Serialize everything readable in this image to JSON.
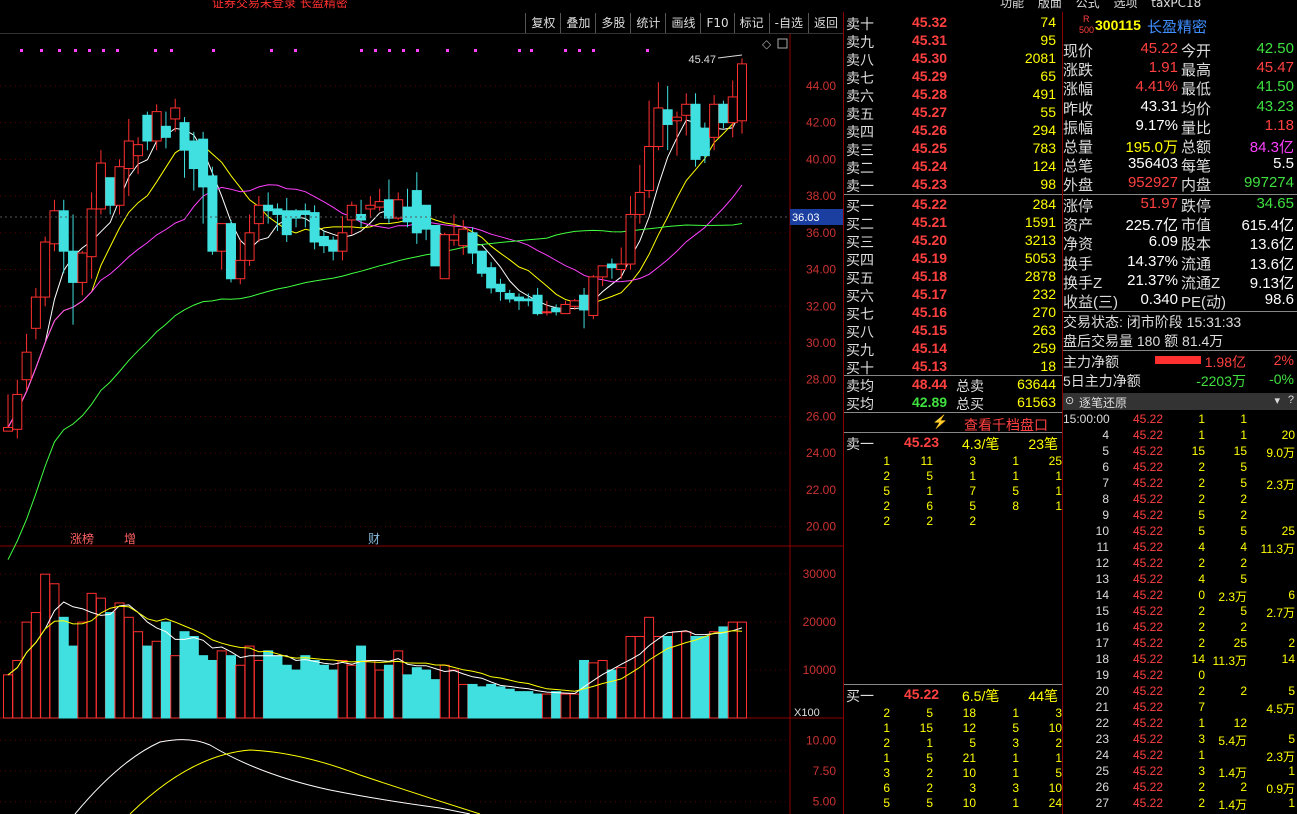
{
  "top_status_text": "证券交易未登录 长盈精密",
  "top_right_menu": [
    "功能",
    "版面",
    "公式",
    "选项",
    "taxPC18"
  ],
  "toolbar": [
    "复权",
    "叠加",
    "多股",
    "统计",
    "画线",
    "F10",
    "标记",
    "-自选",
    "返回"
  ],
  "chart_labels": {
    "high_marker": "45.47",
    "cursor_price": "36.03",
    "vol_unit": "X100",
    "events": [
      "涨榜",
      "增",
      "财"
    ]
  },
  "price_axis": [
    "44.00",
    "42.00",
    "40.00",
    "38.00",
    "36.00",
    "34.00",
    "32.00",
    "30.00",
    "28.00",
    "26.00",
    "24.00",
    "22.00",
    "20.00"
  ],
  "vol_axis": [
    "30000",
    "20000",
    "10000"
  ],
  "macd_axis": [
    "10.00",
    "7.50",
    "5.00"
  ],
  "chart_data": {
    "type": "candlestick",
    "ylim": [
      19,
      46.5
    ],
    "candles": [
      [
        25.2,
        25.4,
        27.2,
        25.2
      ],
      [
        25.3,
        27.2,
        28.0,
        24.8
      ],
      [
        28.0,
        29.5,
        30.5,
        27.4
      ],
      [
        30.8,
        32.5,
        33.0,
        30.2
      ],
      [
        32.5,
        35.5,
        35.8,
        32.0
      ],
      [
        35.4,
        37.2,
        37.8,
        35.0
      ],
      [
        37.2,
        35.0,
        37.8,
        33.8
      ],
      [
        35.0,
        33.3,
        37.0,
        31.0
      ],
      [
        33.3,
        34.9,
        35.0,
        32.6
      ],
      [
        34.7,
        37.3,
        38.2,
        33.5
      ],
      [
        37.3,
        39.8,
        40.5,
        37.0
      ],
      [
        39.0,
        37.5,
        39.0,
        37.0
      ],
      [
        37.5,
        39.6,
        40.0,
        37.0
      ],
      [
        39.5,
        41.0,
        42.2,
        38.0
      ],
      [
        40.2,
        40.8,
        41.2,
        39.2
      ],
      [
        42.4,
        41.0,
        42.6,
        40.5
      ],
      [
        41.0,
        42.6,
        43.0,
        40.5
      ],
      [
        41.8,
        41.2,
        42.6,
        40.6
      ],
      [
        42.2,
        42.8,
        43.3,
        41.5
      ],
      [
        42.0,
        40.5,
        42.3,
        39.0
      ],
      [
        41.0,
        39.5,
        41.5,
        38.3
      ],
      [
        41.1,
        38.5,
        41.5,
        36.5
      ],
      [
        39.1,
        35.0,
        39.6,
        34.8
      ],
      [
        35.0,
        36.5,
        36.5,
        34.0
      ],
      [
        36.5,
        33.5,
        36.7,
        33.3
      ],
      [
        33.5,
        34.5,
        35.6,
        33.2
      ],
      [
        34.5,
        36.0,
        37.0,
        34.2
      ],
      [
        36.5,
        37.5,
        38.0,
        35.5
      ],
      [
        37.5,
        37.2,
        38.2,
        36.5
      ],
      [
        37.3,
        37.0,
        37.6,
        36.1
      ],
      [
        37.2,
        35.9,
        37.9,
        35.5
      ],
      [
        37.2,
        36.8,
        37.3,
        36.3
      ],
      [
        37.2,
        37.0,
        37.6,
        36.3
      ],
      [
        37.1,
        35.5,
        37.5,
        35.1
      ],
      [
        35.8,
        35.3,
        36.1,
        34.9
      ],
      [
        35.6,
        35.0,
        35.8,
        34.5
      ],
      [
        35.0,
        36.0,
        36.9,
        34.5
      ],
      [
        36.7,
        37.5,
        37.7,
        35.9
      ],
      [
        37.0,
        36.7,
        37.8,
        36.3
      ],
      [
        37.3,
        37.5,
        38.0,
        36.8
      ],
      [
        37.4,
        37.7,
        38.4,
        37.2
      ],
      [
        37.8,
        36.8,
        38.9,
        36.5
      ],
      [
        36.8,
        37.8,
        38.2,
        36.7
      ],
      [
        37.4,
        36.6,
        38.4,
        36.3
      ],
      [
        38.3,
        36.0,
        39.3,
        35.4
      ],
      [
        37.5,
        36.2,
        37.5,
        35.6
      ],
      [
        36.4,
        34.2,
        36.4,
        34.2
      ],
      [
        33.5,
        35.9,
        36.0,
        33.5
      ],
      [
        35.6,
        35.9,
        37.0,
        35.3
      ],
      [
        35.3,
        36.2,
        36.7,
        34.8
      ],
      [
        36.0,
        34.9,
        36.3,
        34.3
      ],
      [
        35.0,
        33.8,
        35.0,
        33.6
      ],
      [
        34.1,
        33.0,
        34.4,
        32.7
      ],
      [
        33.2,
        32.8,
        33.5,
        32.3
      ],
      [
        32.7,
        32.4,
        32.9,
        32.2
      ],
      [
        32.5,
        32.3,
        32.7,
        31.8
      ],
      [
        32.4,
        32.3,
        32.7,
        32.0
      ],
      [
        32.6,
        31.6,
        33.0,
        31.5
      ],
      [
        31.7,
        31.7,
        32.3,
        31.5
      ],
      [
        31.9,
        31.7,
        32.1,
        31.5
      ],
      [
        31.6,
        32.1,
        32.3,
        31.6
      ],
      [
        32.0,
        32.3,
        32.4,
        31.8
      ],
      [
        32.6,
        31.8,
        33.0,
        30.8
      ],
      [
        31.5,
        33.6,
        33.7,
        31.3
      ],
      [
        33.6,
        34.2,
        34.2,
        33.1
      ],
      [
        34.3,
        34.1,
        34.6,
        33.5
      ],
      [
        34.0,
        34.3,
        35.2,
        33.5
      ],
      [
        34.3,
        37.0,
        38.0,
        34.0
      ],
      [
        37.0,
        38.2,
        39.7,
        36.5
      ],
      [
        38.3,
        40.7,
        43.2,
        37.9
      ],
      [
        40.7,
        42.8,
        44.2,
        40.5
      ],
      [
        42.7,
        41.9,
        44.0,
        40.5
      ],
      [
        42.1,
        42.3,
        42.6,
        40.2
      ],
      [
        42.4,
        43.0,
        43.6,
        41.3
      ],
      [
        43.0,
        40.0,
        43.6,
        39.6
      ],
      [
        41.7,
        40.2,
        42.0,
        39.8
      ],
      [
        41.2,
        43.0,
        43.5,
        40.5
      ],
      [
        43.0,
        42.0,
        43.2,
        41.7
      ],
      [
        42.0,
        43.4,
        44.3,
        41.2
      ],
      [
        42.1,
        45.2,
        45.5,
        41.4
      ]
    ],
    "vol": [
      9000,
      12000,
      20000,
      22000,
      30000,
      28000,
      21000,
      15000,
      20000,
      26000,
      25000,
      22000,
      24000,
      21000,
      18000,
      15000,
      16000,
      20000,
      13000,
      18000,
      17000,
      13000,
      12000,
      14000,
      13000,
      11000,
      15000,
      12000,
      14000,
      13000,
      11000,
      10000,
      13000,
      12000,
      11000,
      10000,
      12000,
      11000,
      15000,
      12000,
      10000,
      11000,
      14000,
      9000,
      10500,
      10000,
      8000,
      11000,
      10000,
      7000,
      7000,
      6500,
      7000,
      6500,
      6000,
      5500,
      5500,
      5000,
      5000,
      5500,
      5000,
      5000,
      12000,
      11500,
      12000,
      10000,
      10500,
      17000,
      17000,
      21000,
      17000,
      17000,
      18000,
      18000,
      17000,
      17000,
      18000,
      19000,
      20000,
      20000
    ],
    "events": [
      {
        "i": 5,
        "label": "涨榜"
      },
      {
        "i": 9,
        "label": "增"
      },
      {
        "i": 29,
        "label": "财"
      }
    ]
  },
  "stock": {
    "badge_top": "R",
    "badge_bottom": "500",
    "code": "300115",
    "name": "长盈精密"
  },
  "ask": [
    {
      "n": "卖十",
      "p": "45.32",
      "v": "74"
    },
    {
      "n": "卖九",
      "p": "45.31",
      "v": "95"
    },
    {
      "n": "卖八",
      "p": "45.30",
      "v": "2081"
    },
    {
      "n": "卖七",
      "p": "45.29",
      "v": "65"
    },
    {
      "n": "卖六",
      "p": "45.28",
      "v": "491"
    },
    {
      "n": "卖五",
      "p": "45.27",
      "v": "55"
    },
    {
      "n": "卖四",
      "p": "45.26",
      "v": "294"
    },
    {
      "n": "卖三",
      "p": "45.25",
      "v": "783"
    },
    {
      "n": "卖二",
      "p": "45.24",
      "v": "124"
    },
    {
      "n": "卖一",
      "p": "45.23",
      "v": "98"
    }
  ],
  "bid": [
    {
      "n": "买一",
      "p": "45.22",
      "v": "284"
    },
    {
      "n": "买二",
      "p": "45.21",
      "v": "1591"
    },
    {
      "n": "买三",
      "p": "45.20",
      "v": "3213"
    },
    {
      "n": "买四",
      "p": "45.19",
      "v": "5053"
    },
    {
      "n": "买五",
      "p": "45.18",
      "v": "2878"
    },
    {
      "n": "买六",
      "p": "45.17",
      "v": "232"
    },
    {
      "n": "买七",
      "p": "45.16",
      "v": "270"
    },
    {
      "n": "买八",
      "p": "45.15",
      "v": "263"
    },
    {
      "n": "买九",
      "p": "45.14",
      "v": "259"
    },
    {
      "n": "买十",
      "p": "45.13",
      "v": "18"
    }
  ],
  "avg": {
    "ask_label": "卖均",
    "ask_p": "48.44",
    "ask_total_label": "总卖",
    "ask_total": "63644",
    "bid_label": "买均",
    "bid_p": "42.89",
    "bid_total_label": "总买",
    "bid_total": "61563"
  },
  "view_thousand": "查看千档盘口",
  "sell1_queue": {
    "label": "卖一",
    "p": "45.23",
    "avg": "4.3/笔",
    "count": "23笔",
    "rows": [
      [
        "1",
        "11",
        "3",
        "1",
        "25"
      ],
      [
        "2",
        "5",
        "1",
        "1",
        "1"
      ],
      [
        "5",
        "1",
        "7",
        "5",
        "1"
      ],
      [
        "2",
        "6",
        "5",
        "8",
        "1"
      ],
      [
        "2",
        "2",
        "2",
        "",
        ""
      ]
    ]
  },
  "buy1_queue": {
    "label": "买一",
    "p": "45.22",
    "avg": "6.5/笔",
    "count": "44笔",
    "rows": [
      [
        "2",
        "5",
        "18",
        "1",
        "3"
      ],
      [
        "1",
        "15",
        "12",
        "5",
        "10"
      ],
      [
        "2",
        "1",
        "5",
        "3",
        "2"
      ],
      [
        "1",
        "5",
        "21",
        "1",
        "1"
      ],
      [
        "3",
        "2",
        "10",
        "1",
        "5"
      ],
      [
        "6",
        "2",
        "3",
        "3",
        "10"
      ],
      [
        "5",
        "5",
        "10",
        "1",
        "24"
      ]
    ]
  },
  "info": [
    {
      "a": "现价",
      "av": "45.22",
      "ac": "red",
      "b": "今开",
      "bv": "42.50",
      "bc": "grn"
    },
    {
      "a": "涨跌",
      "av": "1.91",
      "ac": "red",
      "b": "最高",
      "bv": "45.47",
      "bc": "red"
    },
    {
      "a": "涨幅",
      "av": "4.41%",
      "ac": "red",
      "b": "最低",
      "bv": "41.50",
      "bc": "grn"
    },
    {
      "a": "昨收",
      "av": "43.31",
      "ac": "wht",
      "b": "均价",
      "bv": "43.23",
      "bc": "grn"
    },
    {
      "a": "振幅",
      "av": "9.17%",
      "ac": "wht",
      "b": "量比",
      "bv": "1.18",
      "bc": "red"
    },
    {
      "a": "总量",
      "av": "195.0万",
      "ac": "yel",
      "b": "总额",
      "bv": "84.3亿",
      "bc": "mag"
    },
    {
      "a": "总笔",
      "av": "356403",
      "ac": "wht",
      "b": "每笔",
      "bv": "5.5",
      "bc": "wht"
    },
    {
      "a": "外盘",
      "av": "952927",
      "ac": "red",
      "b": "内盘",
      "bv": "997274",
      "bc": "grn"
    }
  ],
  "info2": [
    {
      "a": "涨停",
      "av": "51.97",
      "ac": "red",
      "b": "跌停",
      "bv": "34.65",
      "bc": "grn"
    },
    {
      "a": "资产",
      "av": "225.7亿",
      "ac": "wht",
      "b": "市值",
      "bv": "615.4亿",
      "bc": "wht"
    },
    {
      "a": "净资",
      "av": "6.09",
      "ac": "wht",
      "b": "股本",
      "bv": "13.6亿",
      "bc": "wht"
    },
    {
      "a": "换手",
      "av": "14.37%",
      "ac": "wht",
      "b": "流通",
      "bv": "13.6亿",
      "bc": "wht"
    },
    {
      "a": "换手Z",
      "av": "21.37%",
      "ac": "wht",
      "b": "流通Z",
      "bv": "9.13亿",
      "bc": "wht"
    },
    {
      "a": "收益(三)",
      "av": "0.340",
      "ac": "wht",
      "b": "PE(动)",
      "bv": "98.6",
      "bc": "wht"
    }
  ],
  "trade_status": "交易状态: 闭市阶段 15:31:33",
  "after_hours": "盘后交易量 180 额 81.4万",
  "main_flow": {
    "label": "主力净额",
    "v": "1.98亿",
    "pct": "2%"
  },
  "main_flow5": {
    "label": "5日主力净额",
    "v": "-2203万",
    "pct": "-0%"
  },
  "ticks_title": "逐笔还原",
  "ticks": [
    [
      "15:00:00",
      "45.22",
      "1",
      "1",
      ""
    ],
    [
      "4",
      "45.22",
      "1",
      "1",
      "20"
    ],
    [
      "5",
      "45.22",
      "15",
      "15",
      "9.0万"
    ],
    [
      "6",
      "45.22",
      "2",
      "5",
      ""
    ],
    [
      "7",
      "45.22",
      "2",
      "5",
      "2.3万"
    ],
    [
      "8",
      "45.22",
      "2",
      "2",
      ""
    ],
    [
      "9",
      "45.22",
      "5",
      "2",
      ""
    ],
    [
      "10",
      "45.22",
      "5",
      "5",
      "25"
    ],
    [
      "11",
      "45.22",
      "4",
      "4",
      "11.3万"
    ],
    [
      "12",
      "45.22",
      "2",
      "2",
      ""
    ],
    [
      "13",
      "45.22",
      "4",
      "5",
      ""
    ],
    [
      "14",
      "45.22",
      "0",
      "2.3万",
      "6"
    ],
    [
      "15",
      "45.22",
      "2",
      "5",
      "2.7万"
    ],
    [
      "16",
      "45.22",
      "2",
      "2",
      ""
    ],
    [
      "17",
      "45.22",
      "2",
      "25",
      "2"
    ],
    [
      "18",
      "45.22",
      "14",
      "11.3万",
      "14"
    ],
    [
      "19",
      "45.22",
      "0",
      "",
      ""
    ],
    [
      "20",
      "45.22",
      "2",
      "2",
      "5"
    ],
    [
      "21",
      "45.22",
      "7",
      "",
      "4.5万"
    ],
    [
      "22",
      "45.22",
      "1",
      "12",
      ""
    ],
    [
      "23",
      "45.22",
      "3",
      "5.4万",
      "5"
    ],
    [
      "24",
      "45.22",
      "1",
      "",
      "2.3万"
    ],
    [
      "25",
      "45.22",
      "3",
      "1.4万",
      "1"
    ],
    [
      "26",
      "45.22",
      "2",
      "2",
      "0.9万"
    ],
    [
      "27",
      "45.22",
      "2",
      "1.4万",
      "1"
    ]
  ]
}
